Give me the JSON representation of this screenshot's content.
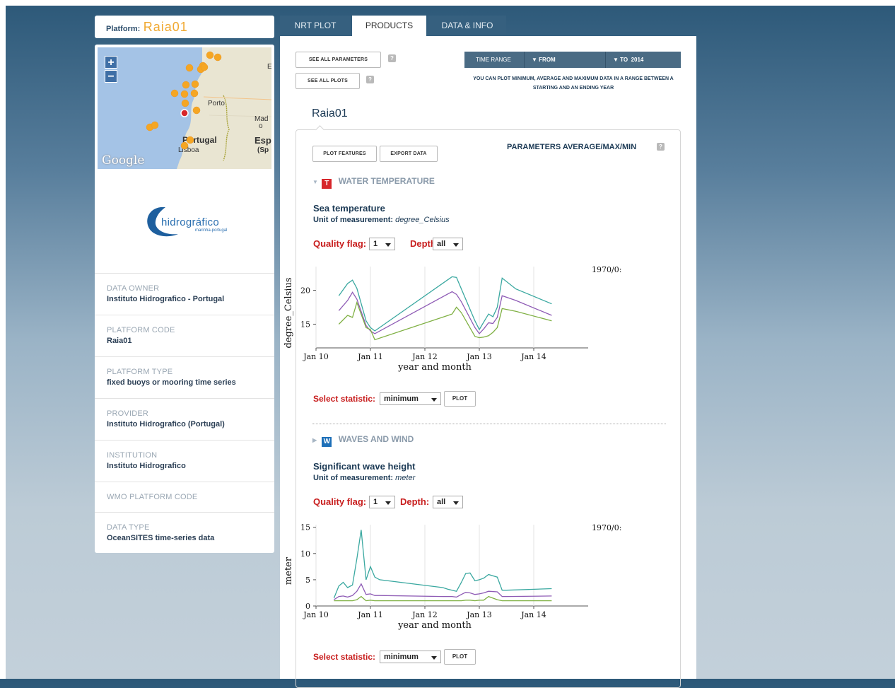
{
  "platform": {
    "label": "Platform:",
    "name": "Raia01"
  },
  "map": {
    "zoom_in": "+",
    "zoom_out": "−",
    "labels": {
      "porto": "Porto",
      "portugal": "Portugal",
      "lisboa": "Lisboa",
      "esp": "Esp",
      "sp": "(Sp",
      "mad": "Mad",
      "o": "o",
      "e": "E"
    },
    "attribution": "Google"
  },
  "logo": {
    "name": "hidrográfico",
    "tagline": "marinha-portugal"
  },
  "info": [
    {
      "key": "DATA OWNER",
      "value": "Instituto Hidrografico - Portugal"
    },
    {
      "key": "PLATFORM CODE",
      "value": "Raia01"
    },
    {
      "key": "PLATFORM TYPE",
      "value": "fixed buoys or mooring time series"
    },
    {
      "key": "PROVIDER",
      "value": "Instituto Hidrografico (Portugal)"
    },
    {
      "key": "INSTITUTION",
      "value": "Instituto Hidrografico"
    },
    {
      "key": "WMO PLATFORM CODE",
      "value": ""
    },
    {
      "key": "DATA TYPE",
      "value": "OceanSITES time-series data"
    }
  ],
  "tabs": [
    {
      "label": "NRT PLOT",
      "active": false
    },
    {
      "label": "PRODUCTS",
      "active": true
    },
    {
      "label": "DATA & INFO",
      "active": false
    }
  ],
  "toolbar": {
    "see_all_parameters": "SEE ALL PARAMETERS",
    "see_all_plots": "SEE ALL PLOTS",
    "help": "?"
  },
  "time_range": {
    "label": "TIME RANGE",
    "from_label": "FROM",
    "to_label": "TO",
    "to_value": "2014",
    "note": "YOU CAN PLOT MINIMUM, AVERAGE AND MAXIMUM DATA IN A RANGE BETWEEN A STARTING AND AN ENDING YEAR"
  },
  "station_title": "Raia01",
  "actions": {
    "plot_features": "PLOT FEATURES",
    "export_data": "EXPORT DATA"
  },
  "pam_title": "PARAMETERS AVERAGE/MAX/MIN",
  "sections": [
    {
      "badge": "T",
      "badge_color": "#d7262b",
      "title": "WATER TEMPERATURE",
      "param": "Sea temperature",
      "unit_label": "Unit of measurement:",
      "unit": "degree_Celsius",
      "quality_label": "Quality flag:",
      "quality_value": "1",
      "depth_label": "Depth:",
      "depth_value": "all",
      "stat_label": "Select statistic:",
      "stat_value": "minimum",
      "plot_button": "PLOT"
    },
    {
      "badge": "W",
      "badge_color": "#1d6fb8",
      "title": "WAVES AND WIND",
      "param": "Significant wave height",
      "unit_label": "Unit of measurement:",
      "unit": "meter",
      "quality_label": "Quality flag:",
      "quality_value": "1",
      "depth_label": "Depth:",
      "depth_value": "all",
      "stat_label": "Select statistic:",
      "stat_value": "minimum",
      "plot_button": "PLOT"
    }
  ],
  "colors": {
    "max": "#3aa8a0",
    "avg": "#8e5bb5",
    "min": "#7fb043"
  },
  "chart_data": [
    {
      "type": "line",
      "xlabel": "year and month",
      "ylabel": "degree_Celsius",
      "x_ticks": [
        "Jan 10",
        "Jan 11",
        "Jan 12",
        "Jan 13",
        "Jan 14"
      ],
      "y_ticks": [
        15,
        20
      ],
      "ylim": [
        11.5,
        23.5
      ],
      "xlim": [
        2010.0,
        2015.0
      ],
      "legend_text": "1970/0:",
      "x": [
        2010.42,
        2010.58,
        2010.67,
        2010.75,
        2010.92,
        2011.0,
        2011.08,
        2012.5,
        2012.58,
        2012.67,
        2012.92,
        2013.0,
        2013.08,
        2013.17,
        2013.25,
        2013.33,
        2013.42,
        2013.67,
        2014.33
      ],
      "series": [
        {
          "name": "max",
          "values": [
            19.2,
            21.0,
            21.5,
            20.3,
            15.5,
            14.5,
            14.0,
            22.0,
            21.9,
            20.2,
            15.5,
            14.2,
            15.3,
            16.5,
            16.1,
            17.5,
            21.8,
            20.2,
            18.0
          ]
        },
        {
          "name": "average",
          "values": [
            17.0,
            18.5,
            19.7,
            18.7,
            14.8,
            14.0,
            13.6,
            19.8,
            19.4,
            18.3,
            14.5,
            13.6,
            14.3,
            15.2,
            15.1,
            16.0,
            19.2,
            18.5,
            16.3
          ]
        },
        {
          "name": "minimum",
          "values": [
            15.0,
            16.3,
            16.0,
            18.2,
            14.5,
            14.2,
            12.7,
            16.5,
            17.5,
            16.7,
            13.2,
            13.0,
            13.1,
            13.3,
            13.8,
            14.5,
            17.3,
            16.9,
            15.5
          ]
        }
      ]
    },
    {
      "type": "line",
      "xlabel": "year and month",
      "ylabel": "meter",
      "x_ticks": [
        "Jan 10",
        "Jan 11",
        "Jan 12",
        "Jan 13",
        "Jan 14"
      ],
      "y_ticks": [
        0,
        5,
        10,
        15
      ],
      "ylim": [
        0,
        15.5
      ],
      "xlim": [
        2010.0,
        2015.0
      ],
      "legend_text": "1970/0:",
      "x": [
        2010.33,
        2010.42,
        2010.5,
        2010.58,
        2010.67,
        2010.75,
        2010.83,
        2010.92,
        2011.0,
        2011.08,
        2011.17,
        2012.33,
        2012.42,
        2012.5,
        2012.58,
        2012.67,
        2012.75,
        2012.83,
        2012.92,
        2013.0,
        2013.08,
        2013.17,
        2013.33,
        2013.42,
        2013.5,
        2014.33
      ],
      "series": [
        {
          "name": "max",
          "values": [
            1.5,
            3.8,
            4.5,
            3.5,
            4.0,
            9.0,
            14.5,
            5.0,
            7.5,
            5.5,
            5.0,
            3.5,
            3.2,
            3.0,
            2.8,
            4.5,
            6.2,
            6.3,
            4.8,
            5.0,
            5.3,
            6.0,
            5.5,
            3.0,
            3.0,
            3.3
          ]
        },
        {
          "name": "average",
          "values": [
            1.2,
            1.8,
            1.9,
            1.7,
            2.0,
            2.8,
            4.2,
            2.2,
            2.3,
            2.0,
            2.0,
            1.8,
            1.8,
            1.8,
            1.7,
            2.2,
            2.6,
            2.5,
            2.2,
            2.3,
            2.5,
            2.8,
            2.7,
            1.8,
            1.8,
            1.9
          ]
        },
        {
          "name": "minimum",
          "values": [
            1.0,
            1.0,
            1.0,
            1.0,
            1.0,
            1.2,
            1.8,
            1.0,
            1.1,
            1.0,
            1.0,
            1.0,
            1.0,
            1.0,
            1.0,
            1.0,
            1.1,
            1.1,
            1.0,
            1.1,
            1.1,
            1.8,
            1.2,
            1.0,
            1.0,
            1.0
          ]
        }
      ]
    }
  ]
}
